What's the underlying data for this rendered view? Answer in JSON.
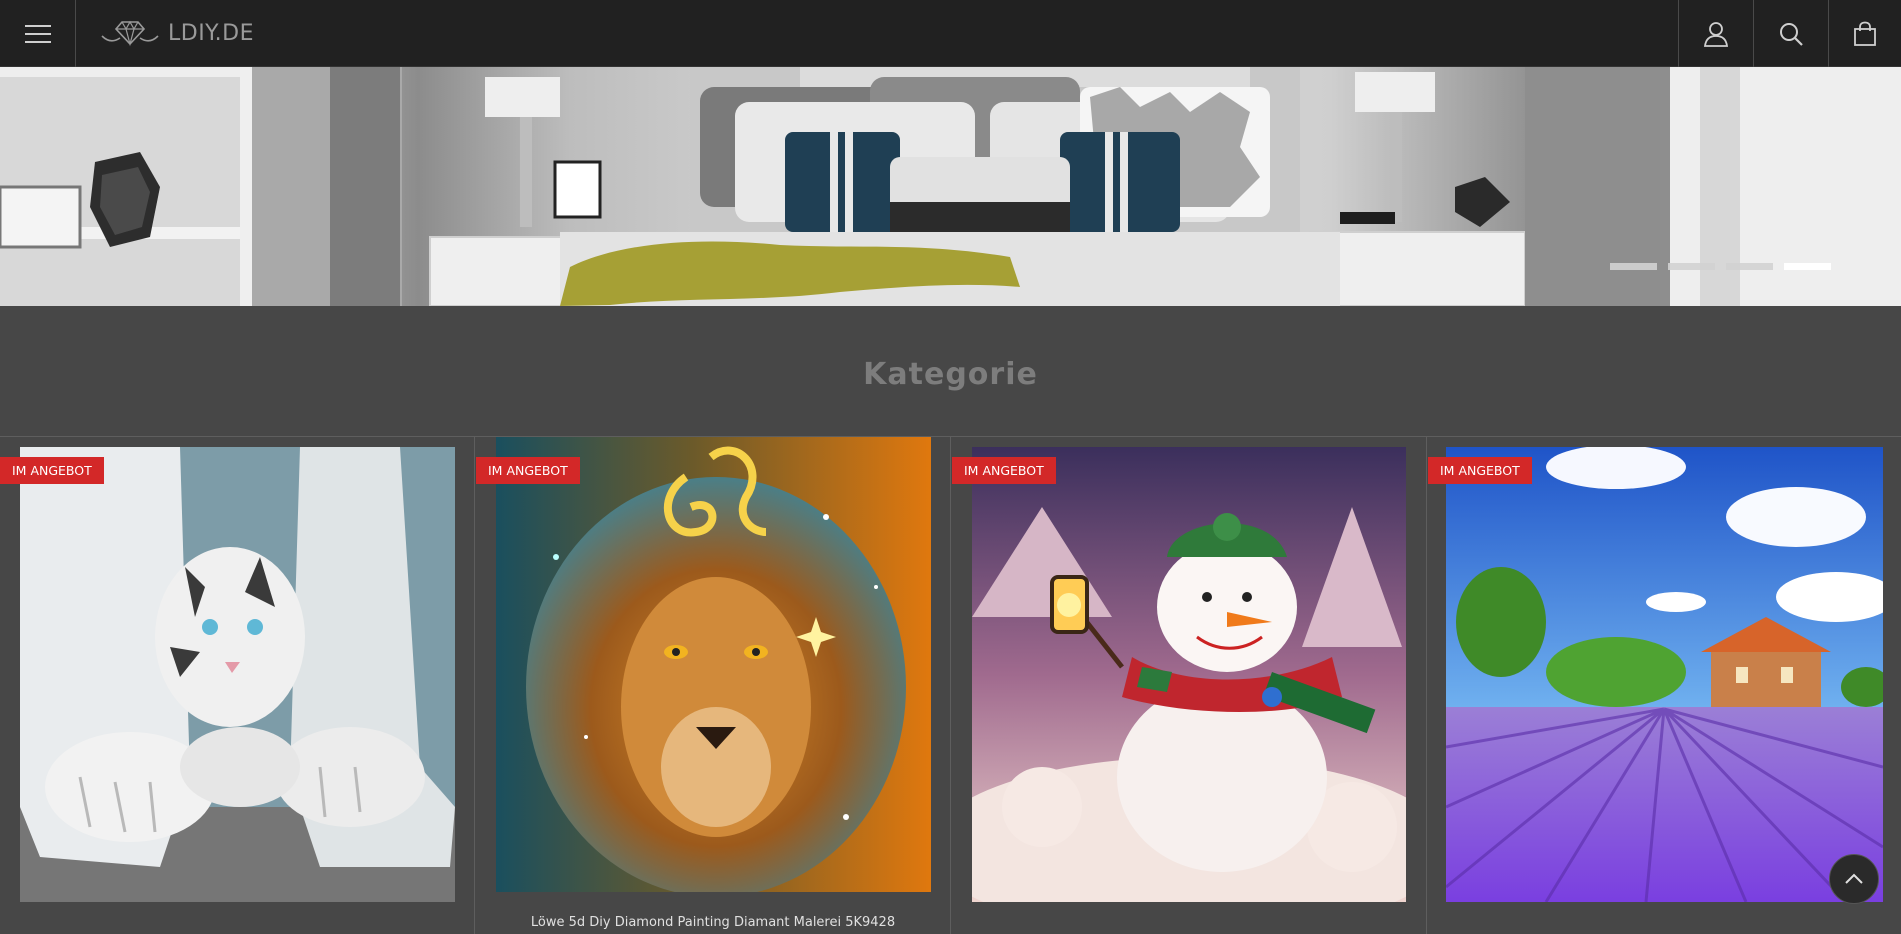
{
  "header": {
    "logo_text": "LDIY.DE",
    "icons": [
      "menu-icon",
      "diamond-logo-icon",
      "account-icon",
      "search-icon",
      "cart-icon"
    ]
  },
  "hero": {
    "slide_count": 4,
    "active_slide": 4
  },
  "category": {
    "title": "Kategorie"
  },
  "products": [
    {
      "badge": "IM ANGEBOT",
      "title": ""
    },
    {
      "badge": "IM ANGEBOT",
      "title": "Löwe 5d Diy Diamond Painting Diamant Malerei 5K9428"
    },
    {
      "badge": "IM ANGEBOT",
      "title": ""
    },
    {
      "badge": "IM ANGEBOT",
      "title": ""
    }
  ],
  "colors": {
    "header_bg": "#212121",
    "page_bg": "#474747",
    "badge_bg": "#d32828",
    "heading": "#7d7d7d"
  }
}
